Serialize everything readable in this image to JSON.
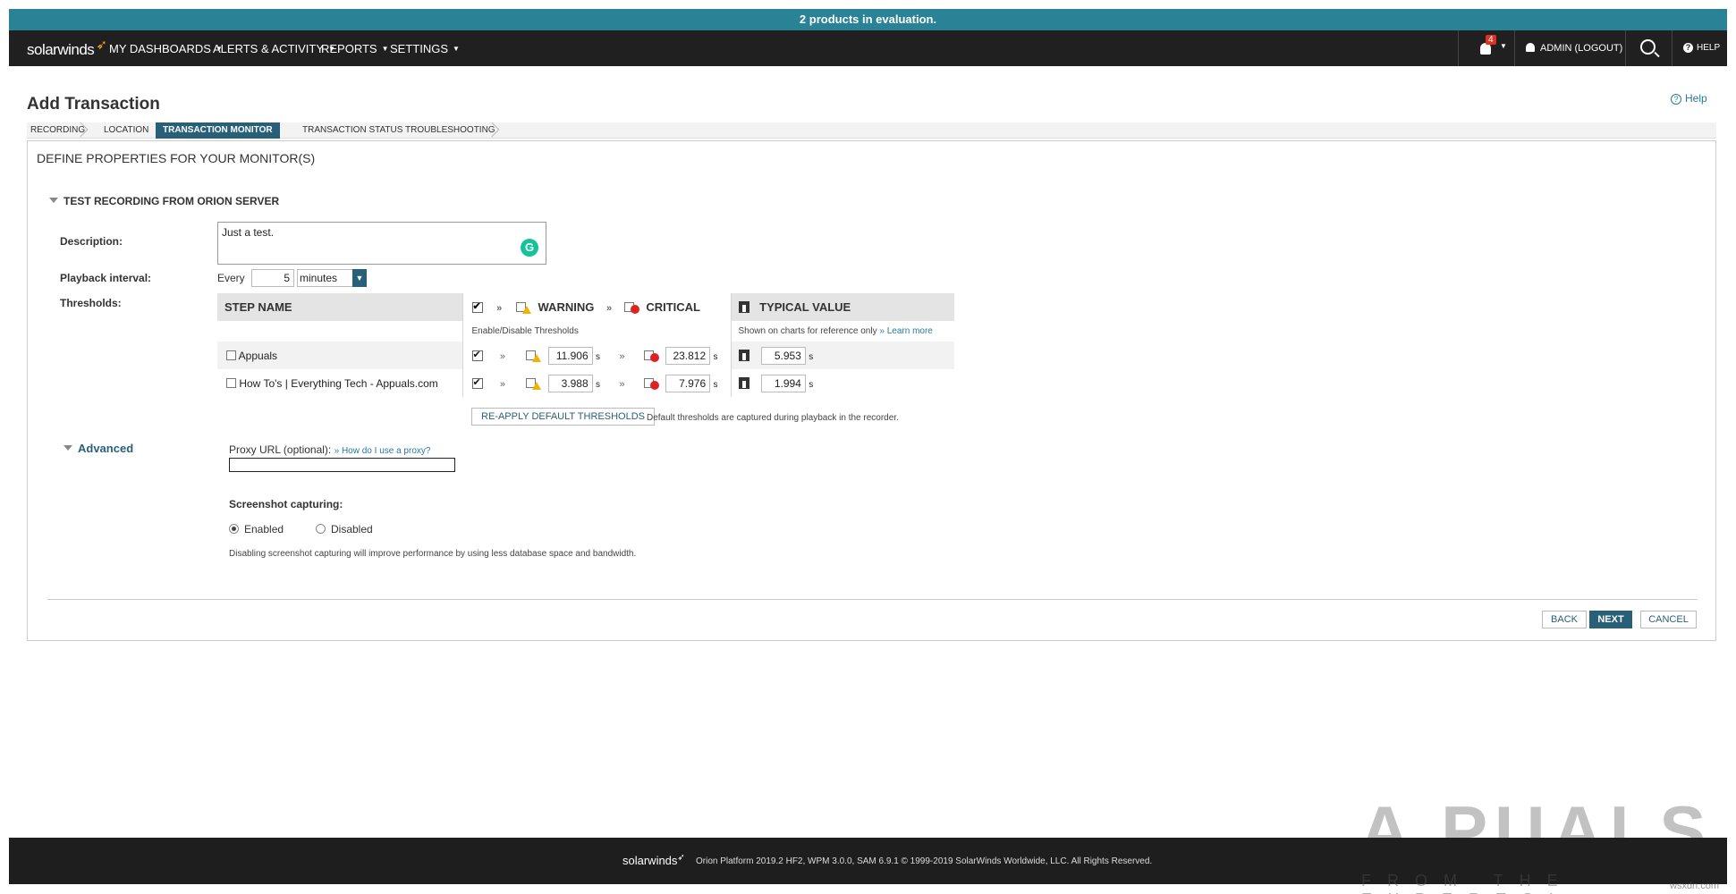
{
  "eval_banner": "2 products in evaluation.",
  "brand": "solarwinds",
  "nav": {
    "items": [
      "MY DASHBOARDS",
      "ALERTS & ACTIVITY",
      "REPORTS",
      "SETTINGS"
    ],
    "notification_count": "4",
    "admin": "ADMIN (LOGOUT)",
    "help": "HELP"
  },
  "page": {
    "title": "Add Transaction",
    "help_link": "Help"
  },
  "wizard": {
    "steps": [
      "RECORDING",
      "LOCATION",
      "TRANSACTION MONITOR",
      "TRANSACTION STATUS TROUBLESHOOTING"
    ],
    "active": "TRANSACTION MONITOR"
  },
  "form": {
    "section_title": "DEFINE PROPERTIES FOR YOUR MONITOR(S)",
    "group_title": "TEST RECORDING FROM ORION SERVER",
    "description_label": "Description:",
    "description_value": "Just a test.",
    "playback_label": "Playback interval:",
    "every": "Every",
    "interval_value": "5",
    "interval_unit": "minutes",
    "thresholds_label": "Thresholds:"
  },
  "thresholds": {
    "col_step": "STEP NAME",
    "col_warning": "WARNING",
    "col_critical": "CRITICAL",
    "col_typical": "TYPICAL VALUE",
    "enable_note": "Enable/Disable Thresholds",
    "typical_note": "Shown on charts for reference only",
    "learn_more": "» Learn more",
    "unit": "s",
    "rows": [
      {
        "name": "Appuals",
        "warning": "11.906",
        "critical": "23.812",
        "typical": "5.953"
      },
      {
        "name": "How To's | Everything Tech - Appuals.com",
        "warning": "3.988",
        "critical": "7.976",
        "typical": "1.994"
      }
    ],
    "reapply_button": "RE-APPLY DEFAULT THRESHOLDS",
    "reapply_note": "Default thresholds are captured during playback in the recorder."
  },
  "advanced": {
    "title": "Advanced",
    "proxy_label": "Proxy URL (optional):",
    "proxy_link": "» How do I use a proxy?",
    "proxy_value": "",
    "screenshot_label": "Screenshot capturing:",
    "enabled": "Enabled",
    "disabled": "Disabled",
    "selected": "Enabled",
    "note": "Disabling screenshot capturing will improve performance by using less database space and bandwidth."
  },
  "buttons": {
    "back": "BACK",
    "next": "NEXT",
    "cancel": "CANCEL"
  },
  "footer": {
    "brand": "solarwinds",
    "text": "Orion Platform 2019.2 HF2, WPM 3.0.0, SAM 6.9.1 © 1999-2019 SolarWinds Worldwide, LLC. All Rights Reserved."
  },
  "watermark": {
    "main": "A PUALS",
    "tagline": "FROM THE EXPERTS!",
    "site": "wsxdn.com"
  },
  "colors": {
    "eval_bar": "#2a8296",
    "nav_bg": "#202020",
    "accent": "#28607a",
    "warning": "#f0b400",
    "critical": "#dd2222"
  }
}
